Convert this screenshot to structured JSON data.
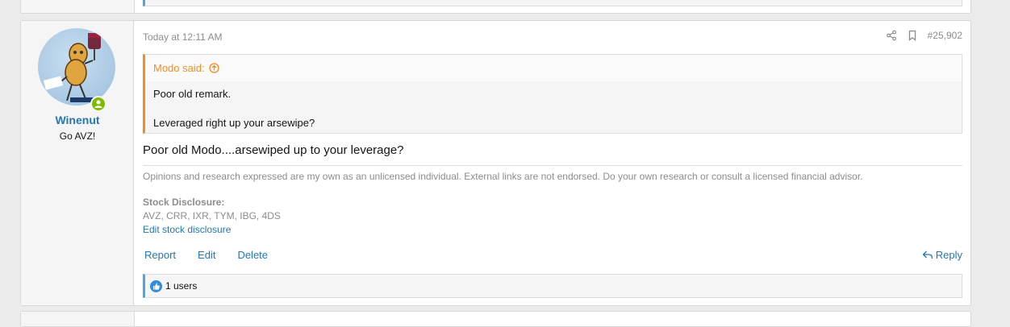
{
  "post": {
    "author": {
      "username": "Winenut",
      "title": "Go AVZ!",
      "online": true
    },
    "date": "Today at 12:11 AM",
    "number": "#25,902",
    "quote": {
      "title": "Modo said:",
      "line1": "Poor old remark.",
      "line2": "Leveraged right up your arsewipe?"
    },
    "message": "Poor old Modo....arsewiped up to your leverage?",
    "signature": {
      "disclaimer": "Opinions and research expressed are my own as an unlicensed individual. External links are not endorsed. Do your own research or consult a licensed financial advisor.",
      "disclosure_title": "Stock Disclosure:",
      "disclosure_list": "AVZ, CRR, IXR, TYM, IBG, 4DS",
      "edit_link": "Edit stock disclosure"
    },
    "actions": {
      "report": "Report",
      "edit": "Edit",
      "delete": "Delete",
      "reply": "Reply"
    },
    "reactions": {
      "summary": "1 users"
    }
  },
  "colors": {
    "link": "#2577b1",
    "quote_accent": "#f78c1f",
    "reaction_accent": "#47a7eb",
    "muted": "#8c8c8c"
  },
  "icons": [
    "share-icon",
    "bookmark-icon",
    "arrow-up-circle-icon",
    "reply-icon",
    "like-icon",
    "user-icon"
  ]
}
